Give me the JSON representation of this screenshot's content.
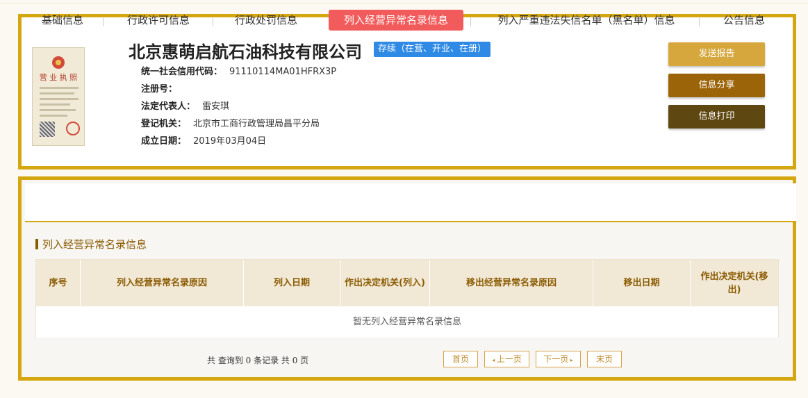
{
  "company": {
    "name": "北京惠萌启航石油科技有限公司",
    "status": "存续（在营、开业、在册）",
    "license_title": "营 业 执 照"
  },
  "info": [
    {
      "key": "统一社会信用代码：",
      "value": "91110114MA01HFRX3P"
    },
    {
      "key": "注册号：",
      "value": ""
    },
    {
      "key": "法定代表人：",
      "value": "雷安琪"
    },
    {
      "key": "登记机关：",
      "value": "北京市工商行政管理局昌平分局"
    },
    {
      "key": "成立日期：",
      "value": "2019年03月04日"
    }
  ],
  "actions": {
    "send": "发送报告",
    "share": "信息分享",
    "print": "信息打印"
  },
  "tabs": [
    {
      "label": "基础信息",
      "active": false
    },
    {
      "label": "行政许可信息",
      "active": false
    },
    {
      "label": "行政处罚信息",
      "active": false
    },
    {
      "label": "列入经营异常名录信息",
      "active": true
    },
    {
      "label": "列入严重违法失信名单（黑名单）信息",
      "active": false
    },
    {
      "label": "公告信息",
      "active": false
    }
  ],
  "section": {
    "title": "列入经营异常名录信息"
  },
  "table": {
    "headers": [
      "序号",
      "列入经营异常名录原因",
      "列入日期",
      "作出决定机关(列入)",
      "移出经营异常名录原因",
      "移出日期",
      "作出决定机关(移出)"
    ],
    "empty_text": "暂无列入经营异常名录信息"
  },
  "pager": {
    "info": "共 查询到 0 条记录 共 0 页",
    "first": "首页",
    "prev": "上一页",
    "next": "下一页",
    "last": "末页"
  },
  "colors": {
    "frame": "#d4a60f",
    "badge": "#2f8ae5",
    "active_tab": "#f25b5b",
    "accent_text": "#8a5a00"
  }
}
